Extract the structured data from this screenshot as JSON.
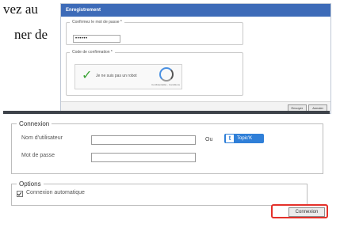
{
  "doc": {
    "line1": "vez au",
    "line2": "ner de"
  },
  "top_panel": {
    "title": "Enregistrement",
    "password_legend": "Confirmez le mot de passe *",
    "password_value": "••••••",
    "code_legend": "Code de confirmation *",
    "captcha_text": "Je ne suis pas un robot",
    "captcha_caption": "Confidentialité - Conditions",
    "btn_send": "Envoyer",
    "btn_reset": "Annuler"
  },
  "login": {
    "legend": "Connexion",
    "username_label": "Nom d'utilisateur",
    "password_label": "Mot de passe",
    "or_text": "Ou",
    "topic_button": "Topic'K",
    "topic_tile": "t",
    "options_legend": "Options",
    "auto_login_label": "Connexion automatique",
    "submit_button": "Connexion"
  },
  "colors": {
    "highlight": "#e4312a",
    "titlebar": "#3d6bb8",
    "topic_button": "#2f7fd8"
  }
}
